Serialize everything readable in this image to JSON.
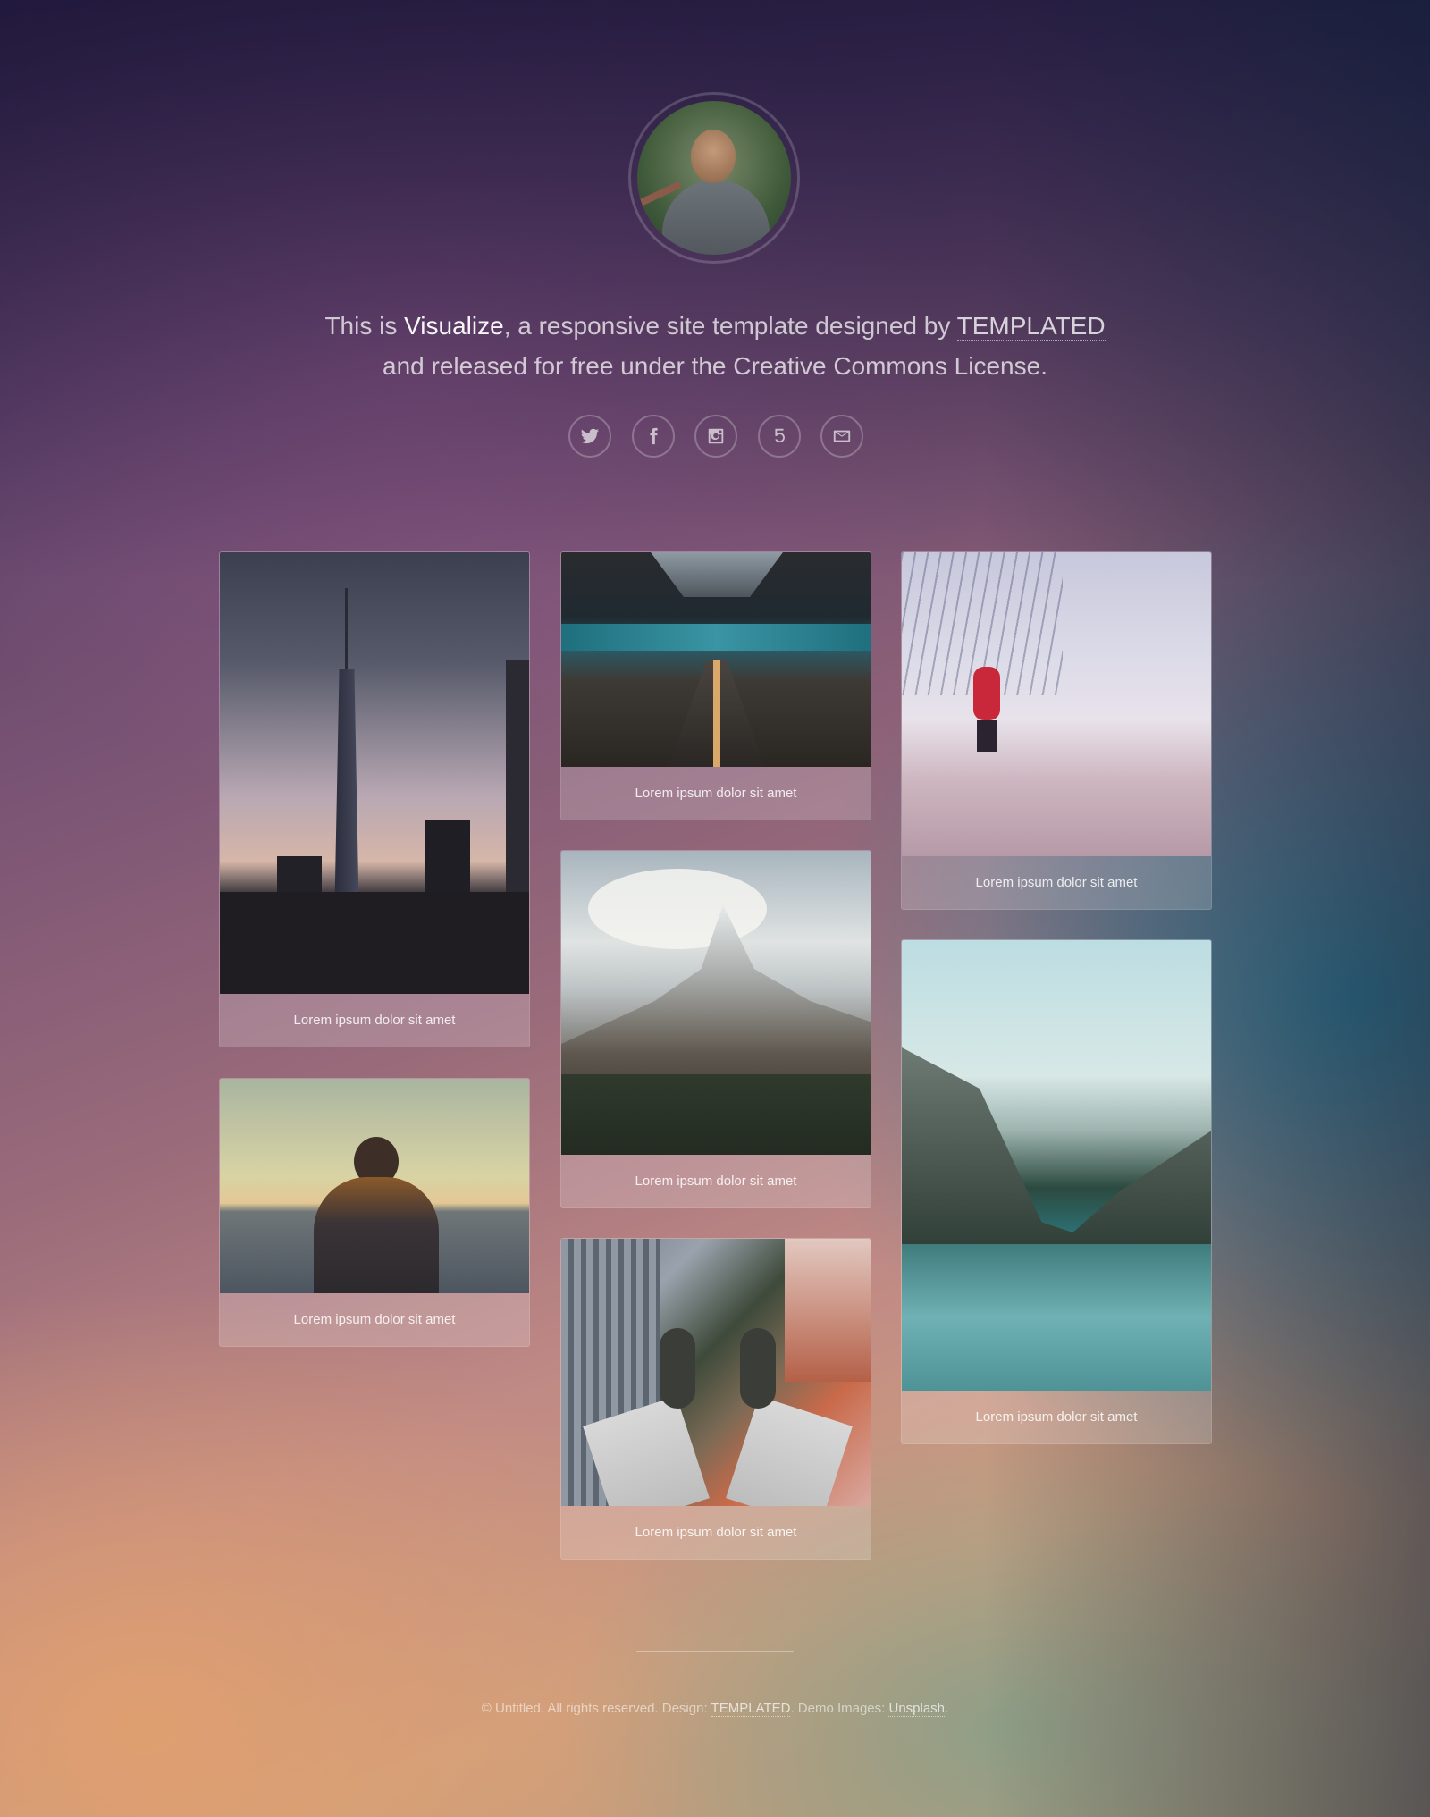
{
  "intro": {
    "line1_prefix": "This is ",
    "brand": "Visualize",
    "line1_middle": ", a responsive site template designed by ",
    "designer_link": "TEMPLATED",
    "line2": "and released for free under the Creative Commons License."
  },
  "socials": [
    {
      "icon": "twitter-icon"
    },
    {
      "icon": "facebook-icon"
    },
    {
      "icon": "instagram-icon"
    },
    {
      "icon": "500px-icon"
    },
    {
      "icon": "envelope-icon"
    }
  ],
  "gallery": [
    {
      "caption": "Lorem ipsum dolor sit amet",
      "scene": "city-skyline"
    },
    {
      "caption": "Lorem ipsum dolor sit amet",
      "scene": "escalator"
    },
    {
      "caption": "Lorem ipsum dolor sit amet",
      "scene": "snow-field"
    },
    {
      "caption": "Lorem ipsum dolor sit amet",
      "scene": "person-sunset"
    },
    {
      "caption": "Lorem ipsum dolor sit amet",
      "scene": "mountain-peak"
    },
    {
      "caption": "Lorem ipsum dolor sit amet",
      "scene": "mountain-lake"
    },
    {
      "caption": "Lorem ipsum dolor sit amet",
      "scene": "feet-over-city"
    }
  ],
  "footer": {
    "copyright": "© Untitled. All rights reserved. Design: ",
    "design_link": "TEMPLATED",
    "demo_label": ". Demo Images: ",
    "images_link": "Unsplash",
    "end": "."
  },
  "colors": {
    "accent_top": "#3b2a4f",
    "accent_right": "#1a7f9a",
    "accent_bottom": "#d9a27a"
  }
}
